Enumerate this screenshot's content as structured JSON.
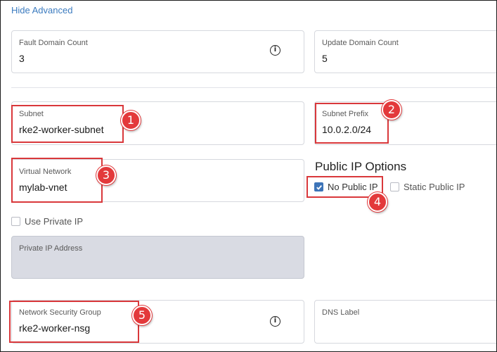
{
  "advanced_toggle": {
    "label": "Hide Advanced"
  },
  "fault_domain": {
    "label": "Fault Domain Count",
    "value": "3",
    "icon": "info-icon"
  },
  "update_domain": {
    "label": "Update Domain Count",
    "value": "5"
  },
  "subnet": {
    "label": "Subnet",
    "value": "rke2-worker-subnet"
  },
  "subnet_prefix": {
    "label": "Subnet Prefix",
    "value": "10.0.2.0/24"
  },
  "virtual_network": {
    "label": "Virtual Network",
    "value": "mylab-vnet"
  },
  "public_ip": {
    "title": "Public IP Options",
    "no_public_ip": {
      "label": "No Public IP",
      "checked": true
    },
    "static_public_ip": {
      "label": "Static Public IP",
      "checked": false
    }
  },
  "use_private_ip": {
    "label": "Use Private IP",
    "checked": false
  },
  "private_ip_address": {
    "label": "Private IP Address",
    "value": ""
  },
  "nsg": {
    "label": "Network Security Group",
    "value": "rke2-worker-nsg",
    "icon": "info-icon"
  },
  "dns_label": {
    "label": "DNS Label",
    "value": ""
  },
  "annotations": [
    "1",
    "2",
    "3",
    "4",
    "5"
  ],
  "colors": {
    "accent": "#3d74b8",
    "link": "#3b7bbf",
    "callout": "#e3393b",
    "disabled_bg": "#d9dbe3"
  }
}
